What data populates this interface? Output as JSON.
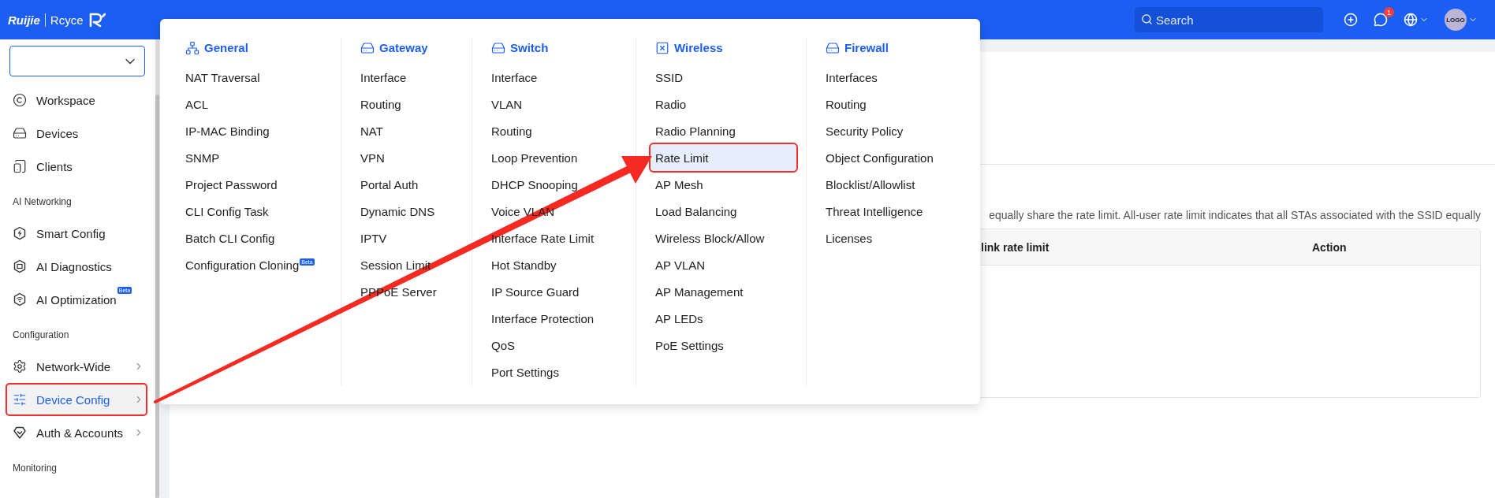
{
  "top_bar": {
    "brand": "Ruijie",
    "product": "Rcyce",
    "search": {
      "placeholder": "Search"
    },
    "message_count": "1",
    "avatar": "LOGO"
  },
  "sidebar": {
    "sections": [
      {
        "items": [
          {
            "label": "Workspace",
            "selected": false,
            "annotated": false,
            "has_submenu": false
          },
          {
            "label": "Devices",
            "selected": false,
            "annotated": false,
            "has_submenu": false
          },
          {
            "label": "Clients",
            "selected": false,
            "annotated": false,
            "has_submenu": false
          }
        ]
      },
      {
        "heading": "AI Networking",
        "items": [
          {
            "label": "Smart Config",
            "selected": false,
            "annotated": false,
            "has_submenu": false
          },
          {
            "label": "AI Diagnostics",
            "selected": false,
            "annotated": false,
            "has_submenu": false
          },
          {
            "label": "AI Optimization",
            "badge": "Beta",
            "selected": false,
            "annotated": false,
            "has_submenu": false
          }
        ]
      },
      {
        "heading": "Configuration",
        "items": [
          {
            "label": "Network-Wide",
            "selected": false,
            "annotated": false,
            "has_submenu": true
          },
          {
            "label": "Device Config",
            "selected": true,
            "annotated": true,
            "has_submenu": true
          },
          {
            "label": "Auth & Accounts",
            "selected": false,
            "annotated": false,
            "has_submenu": true
          }
        ]
      },
      {
        "heading": "Monitoring"
      }
    ]
  },
  "mega_menu": {
    "columns": [
      {
        "title": "General",
        "items": [
          {
            "label": "NAT Traversal",
            "selected": false,
            "annotated": false
          },
          {
            "label": "ACL",
            "selected": false,
            "annotated": false
          },
          {
            "label": "IP-MAC Binding",
            "selected": false,
            "annotated": false
          },
          {
            "label": "SNMP",
            "selected": false,
            "annotated": false
          },
          {
            "label": "Project Password",
            "selected": false,
            "annotated": false
          },
          {
            "label": "CLI Config Task",
            "selected": false,
            "annotated": false
          },
          {
            "label": "Batch CLI Config",
            "selected": false,
            "annotated": false
          },
          {
            "label": "Configuration Cloning",
            "badge": "Beta",
            "selected": false,
            "annotated": false
          }
        ]
      },
      {
        "title": "Gateway",
        "items": [
          {
            "label": "Interface",
            "selected": false,
            "annotated": false
          },
          {
            "label": "Routing",
            "selected": false,
            "annotated": false
          },
          {
            "label": "NAT",
            "selected": false,
            "annotated": false
          },
          {
            "label": "VPN",
            "selected": false,
            "annotated": false
          },
          {
            "label": "Portal Auth",
            "selected": false,
            "annotated": false
          },
          {
            "label": "Dynamic DNS",
            "selected": false,
            "annotated": false
          },
          {
            "label": "IPTV",
            "selected": false,
            "annotated": false
          },
          {
            "label": "Session Limit",
            "selected": false,
            "annotated": false
          },
          {
            "label": "PPPoE Server",
            "selected": false,
            "annotated": false
          }
        ]
      },
      {
        "title": "Switch",
        "items": [
          {
            "label": "Interface",
            "selected": false,
            "annotated": false
          },
          {
            "label": "VLAN",
            "selected": false,
            "annotated": false
          },
          {
            "label": "Routing",
            "selected": false,
            "annotated": false
          },
          {
            "label": "Loop Prevention",
            "selected": false,
            "annotated": false
          },
          {
            "label": "DHCP Snooping",
            "selected": false,
            "annotated": false
          },
          {
            "label": "Voice VLAN",
            "selected": false,
            "annotated": false
          },
          {
            "label": "Interface Rate Limit",
            "selected": false,
            "annotated": false
          },
          {
            "label": "Hot Standby",
            "selected": false,
            "annotated": false
          },
          {
            "label": "IP Source Guard",
            "selected": false,
            "annotated": false
          },
          {
            "label": "Interface Protection",
            "selected": false,
            "annotated": false
          },
          {
            "label": "QoS",
            "selected": false,
            "annotated": false
          },
          {
            "label": "Port Settings",
            "selected": false,
            "annotated": false
          }
        ]
      },
      {
        "title": "Wireless",
        "items": [
          {
            "label": "SSID",
            "selected": false,
            "annotated": false
          },
          {
            "label": "Radio",
            "selected": false,
            "annotated": false
          },
          {
            "label": "Radio Planning",
            "selected": false,
            "annotated": false
          },
          {
            "label": "Rate Limit",
            "selected": true,
            "annotated": true
          },
          {
            "label": "AP Mesh",
            "selected": false,
            "annotated": false
          },
          {
            "label": "Load Balancing",
            "selected": false,
            "annotated": false
          },
          {
            "label": "Wireless Block/Allow",
            "selected": false,
            "annotated": false
          },
          {
            "label": "AP VLAN",
            "selected": false,
            "annotated": false
          },
          {
            "label": "AP Management",
            "selected": false,
            "annotated": false
          },
          {
            "label": "AP LEDs",
            "selected": false,
            "annotated": false
          },
          {
            "label": "PoE Settings",
            "selected": false,
            "annotated": false
          }
        ]
      },
      {
        "title": "Firewall",
        "items": [
          {
            "label": "Interfaces",
            "selected": false,
            "annotated": false
          },
          {
            "label": "Routing",
            "selected": false,
            "annotated": false
          },
          {
            "label": "Security Policy",
            "selected": false,
            "annotated": false
          },
          {
            "label": "Object Configuration",
            "selected": false,
            "annotated": false
          },
          {
            "label": "Blocklist/Allowlist",
            "selected": false,
            "annotated": false
          },
          {
            "label": "Threat Intelligence",
            "selected": false,
            "annotated": false
          },
          {
            "label": "Licenses",
            "selected": false,
            "annotated": false
          }
        ]
      }
    ]
  },
  "content": {
    "description": "equally share the rate limit. All-user rate limit indicates that all STAs associated with the SSID equally",
    "table": {
      "columns": [
        "link rate limit",
        "Action"
      ]
    }
  }
}
